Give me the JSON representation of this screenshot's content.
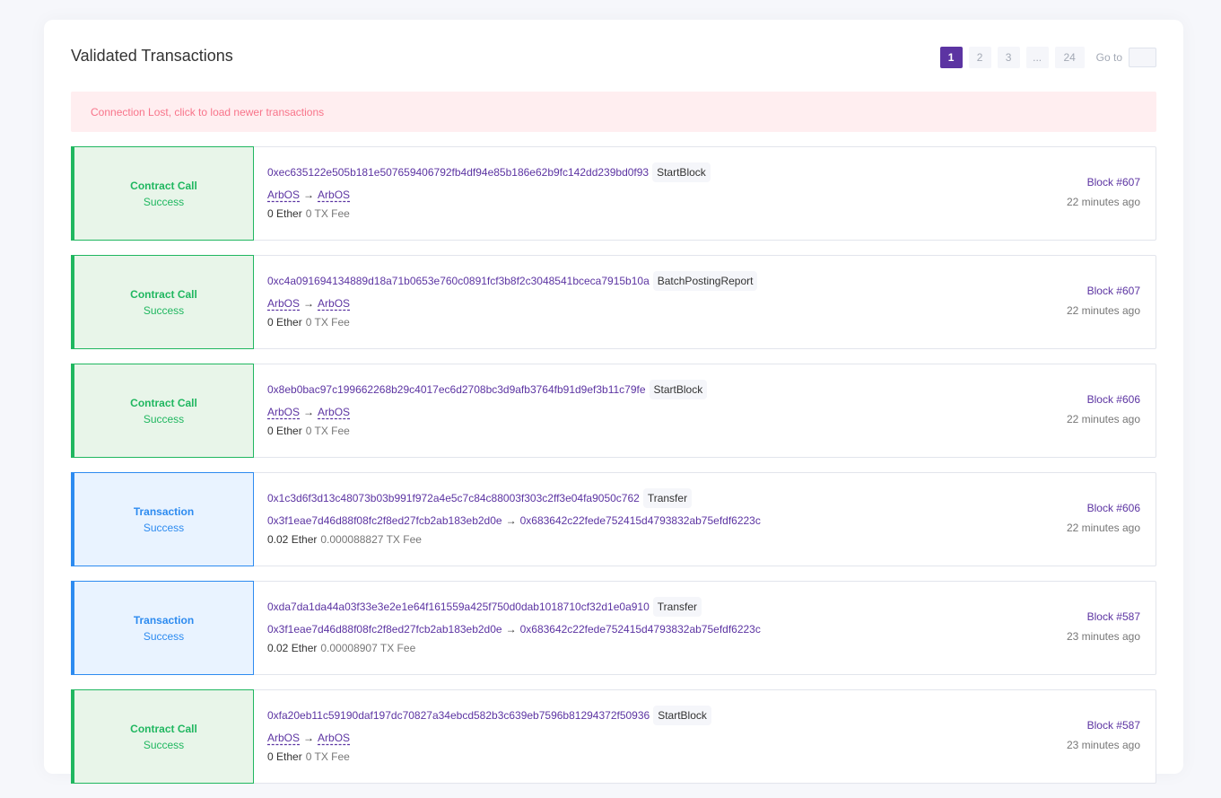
{
  "page": {
    "title": "Validated Transactions",
    "alert": "Connection Lost, click to load newer transactions"
  },
  "pagination": {
    "pages": [
      "1",
      "2",
      "3",
      "...",
      "24"
    ],
    "current": "1",
    "goto_label": "Go to",
    "goto_value": ""
  },
  "colors": {
    "accent": "#5c34a2",
    "contract_call": "#20b760",
    "transaction": "#2d8bf0",
    "alert_text": "#f8748a"
  },
  "transactions": [
    {
      "kind": "call",
      "type": "Contract Call",
      "status": "Success",
      "hash": "0xec635122e505b181e507659406792fb4df94e85b186e62b9fc142dd239bd0f93",
      "method": "StartBlock",
      "from": "ArbOS",
      "to": "ArbOS",
      "arrow": "→",
      "amount": "0 Ether",
      "fee": "0 TX Fee",
      "block": "Block #607",
      "age": "22 minutes ago"
    },
    {
      "kind": "call",
      "type": "Contract Call",
      "status": "Success",
      "hash": "0xc4a091694134889d18a71b0653e760c0891fcf3b8f2c3048541bceca7915b10a",
      "method": "BatchPostingReport",
      "from": "ArbOS",
      "to": "ArbOS",
      "arrow": "→",
      "amount": "0 Ether",
      "fee": "0 TX Fee",
      "block": "Block #607",
      "age": "22 minutes ago"
    },
    {
      "kind": "call",
      "type": "Contract Call",
      "status": "Success",
      "hash": "0x8eb0bac97c199662268b29c4017ec6d2708bc3d9afb3764fb91d9ef3b11c79fe",
      "method": "StartBlock",
      "from": "ArbOS",
      "to": "ArbOS",
      "arrow": "→",
      "amount": "0 Ether",
      "fee": "0 TX Fee",
      "block": "Block #606",
      "age": "22 minutes ago"
    },
    {
      "kind": "transfer",
      "type": "Transaction",
      "status": "Success",
      "hash": "0x1c3d6f3d13c48073b03b991f972a4e5c7c84c88003f303c2ff3e04fa9050c762",
      "method": "Transfer",
      "from": "0x3f1eae7d46d88f08fc2f8ed27fcb2ab183eb2d0e",
      "to": "0x683642c22fede752415d4793832ab75efdf6223c",
      "arrow": "→",
      "amount": "0.02 Ether",
      "fee": "0.000088827 TX Fee",
      "block": "Block #606",
      "age": "22 minutes ago"
    },
    {
      "kind": "transfer",
      "type": "Transaction",
      "status": "Success",
      "hash": "0xda7da1da44a03f33e3e2e1e64f161559a425f750d0dab1018710cf32d1e0a910",
      "method": "Transfer",
      "from": "0x3f1eae7d46d88f08fc2f8ed27fcb2ab183eb2d0e",
      "to": "0x683642c22fede752415d4793832ab75efdf6223c",
      "arrow": "→",
      "amount": "0.02 Ether",
      "fee": "0.00008907 TX Fee",
      "block": "Block #587",
      "age": "23 minutes ago"
    },
    {
      "kind": "call",
      "type": "Contract Call",
      "status": "Success",
      "hash": "0xfa20eb11c59190daf197dc70827a34ebcd582b3c639eb7596b81294372f50936",
      "method": "StartBlock",
      "from": "ArbOS",
      "to": "ArbOS",
      "arrow": "→",
      "amount": "0 Ether",
      "fee": "0 TX Fee",
      "block": "Block #587",
      "age": "23 minutes ago"
    }
  ]
}
